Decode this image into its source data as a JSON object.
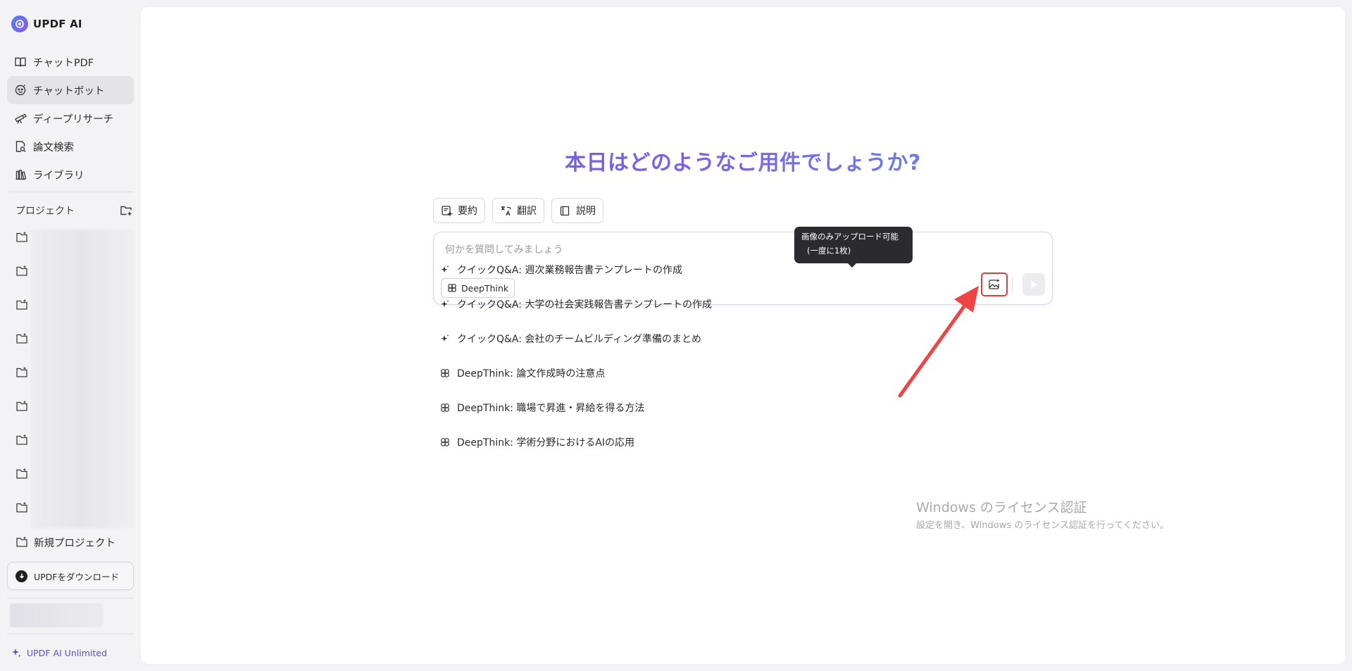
{
  "app": {
    "name": "UPDF AI"
  },
  "sidebar": {
    "nav": [
      {
        "label": "チャットPDF",
        "icon": "book-icon"
      },
      {
        "label": "チャットボット",
        "icon": "bot-icon",
        "active": true
      },
      {
        "label": "ディープリサーチ",
        "icon": "telescope-icon"
      },
      {
        "label": "論文検索",
        "icon": "document-search-icon"
      },
      {
        "label": "ライブラリ",
        "icon": "library-icon"
      }
    ],
    "projects_label": "プロジェクト",
    "new_project_label": "新規プロジェクト",
    "download_label": "UPDFをダウンロード",
    "unlimited_label": "UPDF AI Unlimited"
  },
  "main": {
    "greeting": "本日はどのようなご用件でしょうか?",
    "chips": [
      {
        "label": "要約",
        "icon": "summary-icon"
      },
      {
        "label": "翻訳",
        "icon": "translate-icon"
      },
      {
        "label": "説明",
        "icon": "explain-book-icon"
      }
    ],
    "input": {
      "placeholder": "何かを質問してみましょう",
      "deepthink_label": "DeepThink"
    },
    "tooltip": {
      "line1": "画像のみアップロード可能",
      "line2": "(一度に1枚)"
    },
    "suggestions": [
      {
        "type": "sparkle",
        "text": "クイックQ&A: 週次業務報告書テンプレートの作成"
      },
      {
        "type": "sparkle",
        "text": "クイックQ&A: 大学の社会実践報告書テンプレートの作成"
      },
      {
        "type": "sparkle",
        "text": "クイックQ&A: 会社のチームビルディング準備のまとめ"
      },
      {
        "type": "deepthink",
        "text": "DeepThink: 論文作成時の注意点"
      },
      {
        "type": "deepthink",
        "text": "DeepThink: 職場で昇進・昇給を得る方法"
      },
      {
        "type": "deepthink",
        "text": "DeepThink: 学術分野におけるAIの応用"
      }
    ]
  },
  "watermark": {
    "line1": "Windows のライセンス認証",
    "line2": "設定を開き、Windows のライセンス認証を行ってください。"
  },
  "colors": {
    "accent": "#5a4fd6",
    "highlight_border": "#e53a3a",
    "arrow": "#ef4444",
    "tooltip_bg": "#2b2b2f"
  }
}
